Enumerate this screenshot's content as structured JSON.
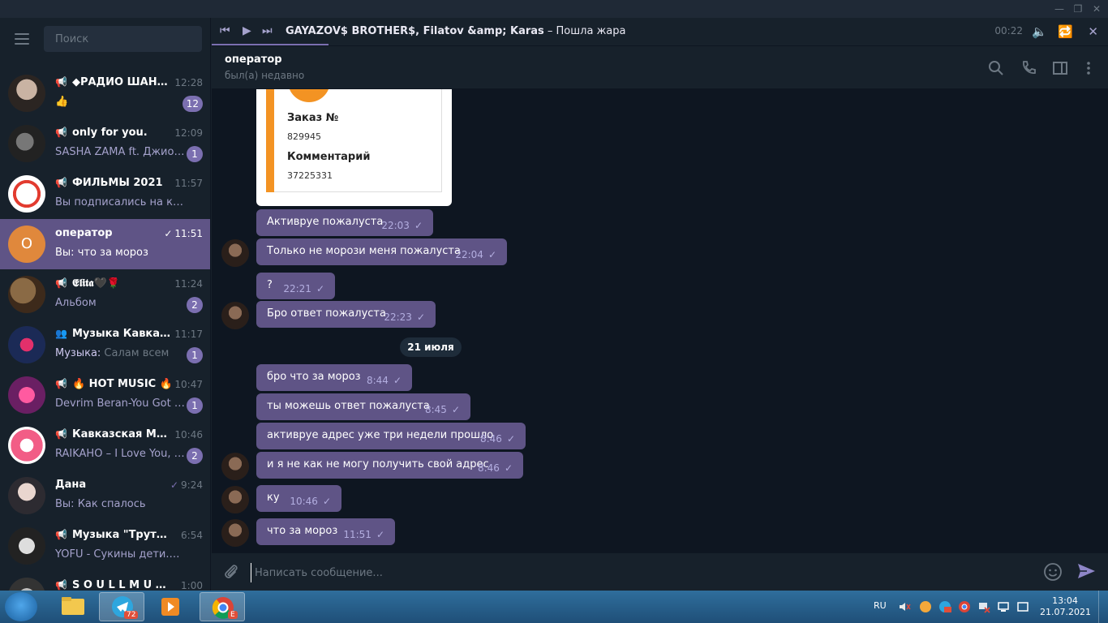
{
  "window": {
    "minimize": "—",
    "maximize": "❐",
    "close": "✕"
  },
  "sidebar": {
    "search_placeholder": "Поиск",
    "chats": [
      {
        "name": "◆РАДИО ШАНСОН",
        "time": "12:28",
        "preview": "👍",
        "badge": "12",
        "channel": true
      },
      {
        "name": "only for you.",
        "time": "12:09",
        "preview": "SASHA ZAMA ft. Джиос – Султ...",
        "badge": "1",
        "channel": true
      },
      {
        "name": "ФИЛЬМЫ 2021",
        "time": "11:57",
        "preview": "Вы подписались на канал",
        "badge": "",
        "channel": true
      },
      {
        "name": "оператор",
        "time": "11:51",
        "preview": "Вы: что за мороз",
        "badge": "",
        "channel": false,
        "active": true,
        "avatar_letter": "О",
        "read": true
      },
      {
        "name": "𝕰𝖑𝖎𝖙𝖆🖤🌹",
        "time": "11:24",
        "preview": "Альбом",
        "badge": "2",
        "channel": true
      },
      {
        "name": "Музыка Кавказа 🔥",
        "time": "11:17",
        "preview_prefix": "Музыка:",
        "preview": " Салам всем",
        "badge": "1",
        "group": true
      },
      {
        "name": "🔥 HOT MUSIC 🔥",
        "time": "10:47",
        "preview": "Devrim Beran-You Got the Lov...",
        "badge": "1",
        "channel": true
      },
      {
        "name": "Кавказская МУЗЫКА",
        "time": "10:46",
        "preview": "RAIKAHO – I Love You, Kaz...",
        "badge": "2",
        "channel": true
      },
      {
        "name": "Дана",
        "time": "9:24",
        "preview": "Вы: Как спалось",
        "badge": "",
        "channel": false,
        "read": true
      },
      {
        "name": "Музыка \"Трутень\"",
        "time": "6:54",
        "preview": "YOFU - Сукины дети.mp3, @...",
        "badge": "",
        "channel": true
      },
      {
        "name": "S O U L L M U S I C",
        "time": "1:00",
        "preview": "",
        "badge": "",
        "channel": true
      }
    ]
  },
  "player": {
    "track_artist": "GAYAZOV$ BROTHER$, Filatov &amp; Karas",
    "track_sep": " – ",
    "track_title": "Пошла жара",
    "time": "00:22",
    "progress": 0.13
  },
  "chat_header": {
    "name": "оператор",
    "status": "был(а) недавно"
  },
  "image_card": {
    "order_label": "Заказ №",
    "order_value": "829945",
    "comment_label": "Комментарий",
    "comment_value": "37225331"
  },
  "messages": [
    {
      "text": "Активруе пожалуста",
      "time": "22:03",
      "avatar": false
    },
    {
      "text": "Только не морози меня пожалуста",
      "time": "22:04",
      "avatar": true
    },
    {
      "text": "?",
      "time": "22:21",
      "avatar": false
    },
    {
      "text": "Бро ответ пожалуста",
      "time": "22:23",
      "avatar": true
    },
    {
      "text": "бро что за мороз",
      "time": "8:44",
      "avatar": false
    },
    {
      "text": "ты можешь ответ пожалуста",
      "time": "8:45",
      "avatar": false
    },
    {
      "text": "активруе адрес уже три недели прошло",
      "time": "8:46",
      "avatar": false
    },
    {
      "text": "и я не как не могу получить свой адрес",
      "time": "8:46",
      "avatar": true
    },
    {
      "text": "ку",
      "time": "10:46",
      "avatar": true
    },
    {
      "text": "что за мороз",
      "time": "11:51",
      "avatar": true
    }
  ],
  "date_separator": "21 июля",
  "composer": {
    "placeholder": "Написать сообщение..."
  },
  "taskbar": {
    "telegram_badge": "72",
    "chrome_badge": "E",
    "lang": "RU",
    "time": "13:04",
    "date": "21.07.2021"
  },
  "colors": {
    "accent": "#5f5486",
    "sidebar_bg": "#17212b",
    "chat_bg": "#0e1621",
    "badge": "#7b6fb0"
  }
}
